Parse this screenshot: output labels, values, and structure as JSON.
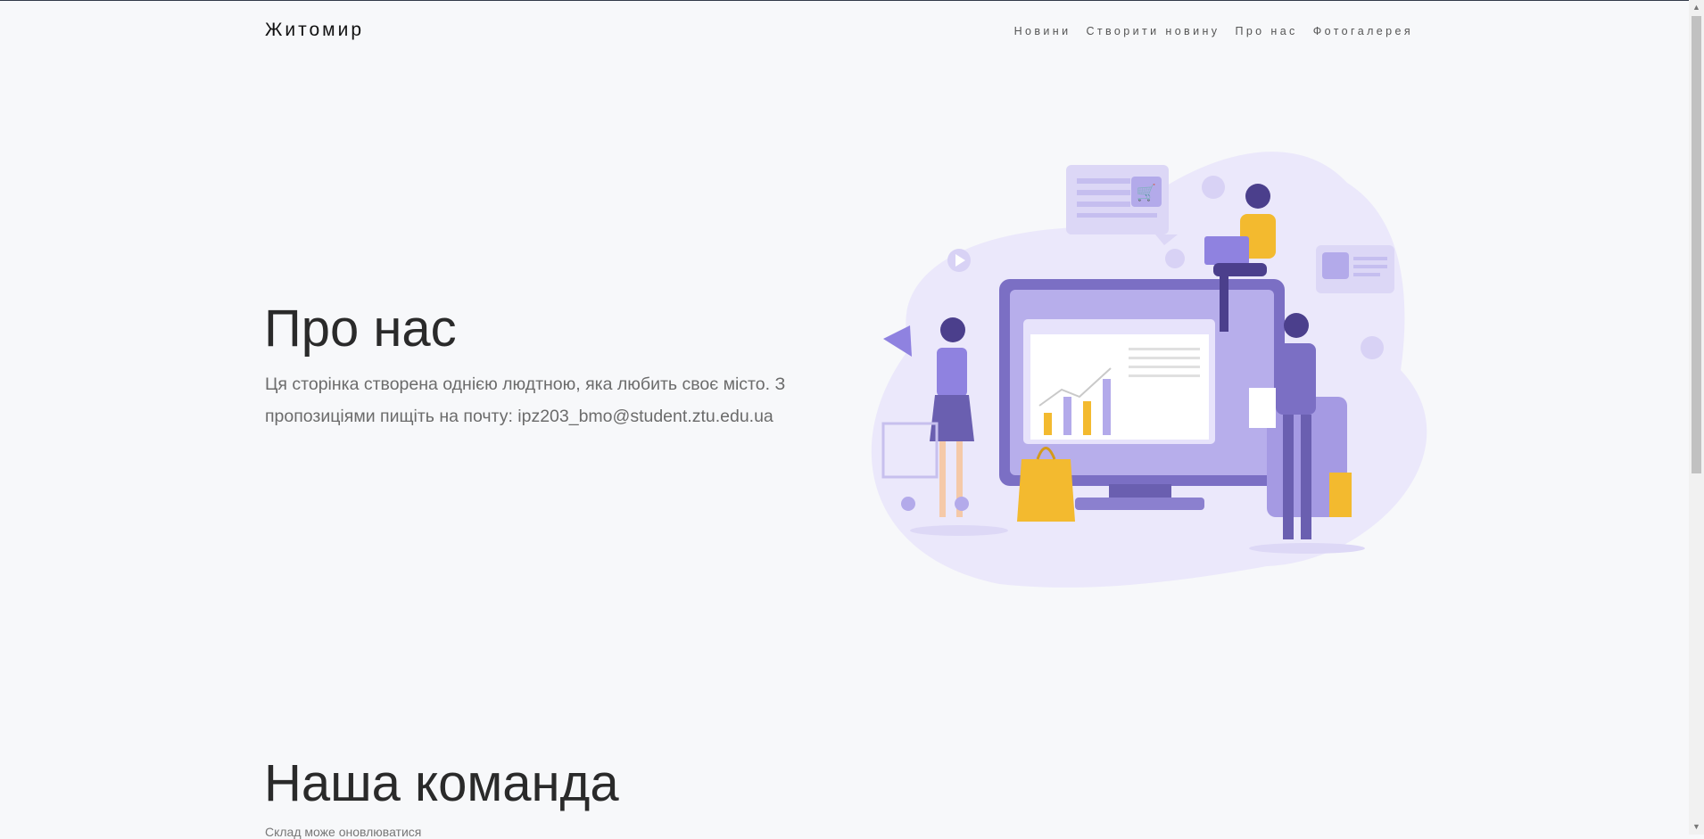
{
  "header": {
    "brand": "Житомир",
    "nav": [
      "Новини",
      "Створити новину",
      "Про нас",
      "Фотогалерея"
    ]
  },
  "about": {
    "title": "Про нас",
    "text": "Ця сторінка створена однією людтною, яка любить своє місто. З пропозиціями пищіть на почту: ipz203_bmo@student.ztu.edu.ua"
  },
  "team": {
    "title": "Наша команда",
    "subtitle": "Склад може оновлюватися"
  },
  "colors": {
    "background": "#f7f8fa",
    "accent_purple": "#7b6fc4",
    "accent_yellow": "#f3ba2f",
    "blob": "#ebe8fb"
  },
  "icons": [
    "megaphone-icon",
    "shopping-cart-icon",
    "shopping-bag-icon",
    "heart-icon",
    "thumbs-up-icon",
    "play-icon",
    "calculator-icon"
  ]
}
